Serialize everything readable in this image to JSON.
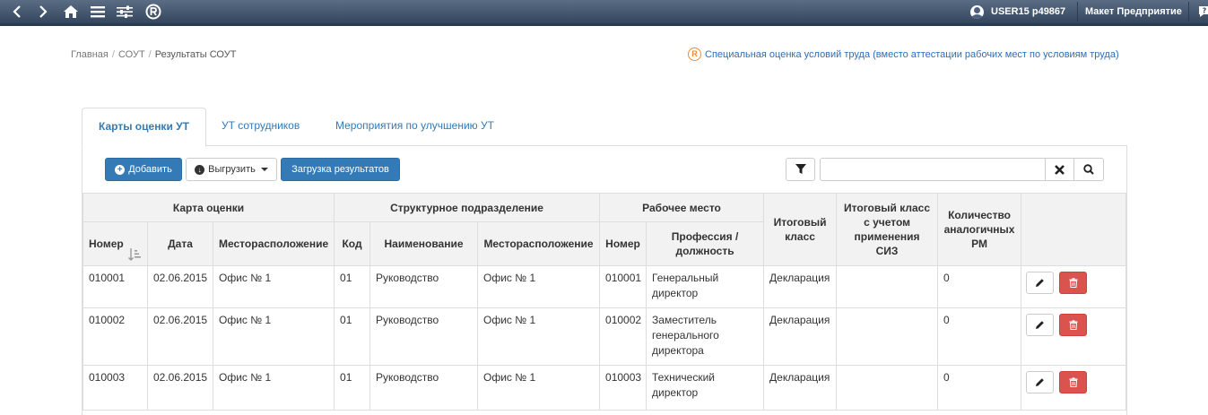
{
  "topbar": {
    "user": "USER15 p49867",
    "org": "Макет Предприятие"
  },
  "breadcrumb": {
    "items": [
      "Главная",
      "СОУТ",
      "Результаты СОУТ"
    ]
  },
  "sout_link": "Специальная оценка условий труда (вместо аттестации рабочих мест по условиям труда)",
  "tabs": [
    "Карты оценки УТ",
    "УТ сотрудников",
    "Мероприятия по улучшению УТ"
  ],
  "toolbar": {
    "add_label": "Добавить",
    "export_label": "Выгрузить",
    "upload_label": "Загрузка результатов",
    "search_value": ""
  },
  "table": {
    "groups": {
      "card": "Карта оценки",
      "unit": "Структурное подразделение",
      "workplace": "Рабочее место",
      "final_class": "Итоговый класс",
      "final_class_siz": "Итоговый класс с учетом применения СИЗ",
      "similar_count": "Количество аналогичных РМ"
    },
    "columns": {
      "number": "Номер",
      "date": "Дата",
      "location": "Месторасположение",
      "code": "Код",
      "name": "Наименование",
      "unit_location": "Месторасположение",
      "wp_number": "Номер",
      "profession": "Профессия / должность"
    },
    "rows": [
      {
        "number": "010001",
        "date": "02.06.2015",
        "location": "Офис № 1",
        "code": "01",
        "name": "Руководство",
        "unit_location": "Офис № 1",
        "wp_number": "010001",
        "profession": "Генеральный директор",
        "final_class": "Декларация",
        "final_class_siz": "",
        "similar": "0"
      },
      {
        "number": "010002",
        "date": "02.06.2015",
        "location": "Офис № 1",
        "code": "01",
        "name": "Руководство",
        "unit_location": "Офис № 1",
        "wp_number": "010002",
        "profession": "Заместитель генерального директора",
        "final_class": "Декларация",
        "final_class_siz": "",
        "similar": "0"
      },
      {
        "number": "010003",
        "date": "02.06.2015",
        "location": "Офис № 1",
        "code": "01",
        "name": "Руководство",
        "unit_location": "Офис № 1",
        "wp_number": "010003",
        "profession": "Технический директор",
        "final_class": "Декларация",
        "final_class_siz": "",
        "similar": "0"
      }
    ]
  }
}
